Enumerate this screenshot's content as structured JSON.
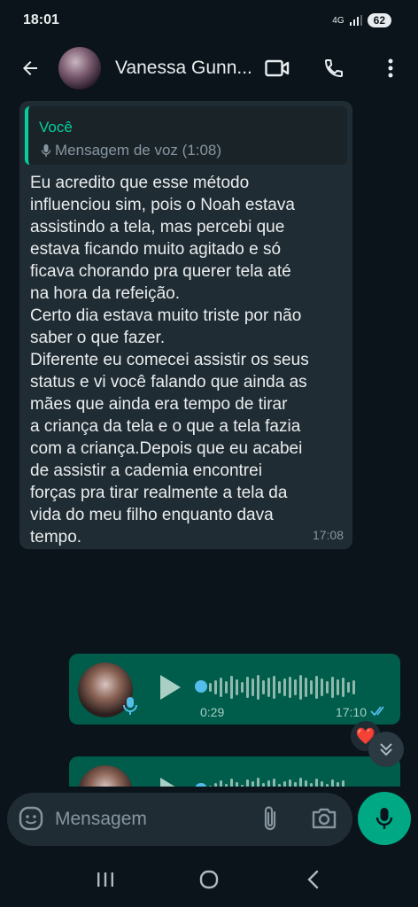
{
  "status_bar": {
    "time": "18:01",
    "network": "4G",
    "battery": "62"
  },
  "header": {
    "contact_name": "Vanessa Gunn..."
  },
  "incoming_message": {
    "quote_author": "Você",
    "quote_text": "Mensagem de voz (1:08)",
    "text": "Eu acredito que esse método\ninfluenciou sim, pois o Noah estava\nassistindo a tela, mas percebi que\nestava ficando muito agitado e  só\nficava chorando pra querer tela até\nna hora da refeição.\nCerto dia estava muito triste por não\nsaber o que fazer.\nDiferente eu comecei assistir os seus\nstatus e vi você falando que ainda as\nmães que ainda era tempo de tirar\na criança da tela e o que a tela fazia\ncom a criança.Depois que eu acabei\nde assistir a cademia encontrei\nforças pra tirar realmente a tela da\nvida do meu filho enquanto dava\ntempo.",
    "time": "17:08"
  },
  "voice_message": {
    "duration": "0:29",
    "time": "17:10",
    "progress": 0,
    "status": "read"
  },
  "reaction": {
    "emoji": "❤️"
  },
  "composer": {
    "placeholder": "Mensagem"
  },
  "colors": {
    "bg": "#0b141a",
    "incoming_bubble": "#202c33",
    "outgoing_bubble": "#005c4b",
    "accent": "#00a884",
    "quote_accent": "#06cf9c",
    "read_ticks": "#53bdeb"
  },
  "icons": [
    "back-arrow-icon",
    "video-call-icon",
    "phone-icon",
    "more-vert-icon",
    "mic-icon",
    "play-icon",
    "read-ticks-icon",
    "chevron-double-down-icon",
    "emoji-icon",
    "attach-icon",
    "camera-icon",
    "nav-recents-icon",
    "nav-home-icon",
    "nav-back-icon"
  ]
}
